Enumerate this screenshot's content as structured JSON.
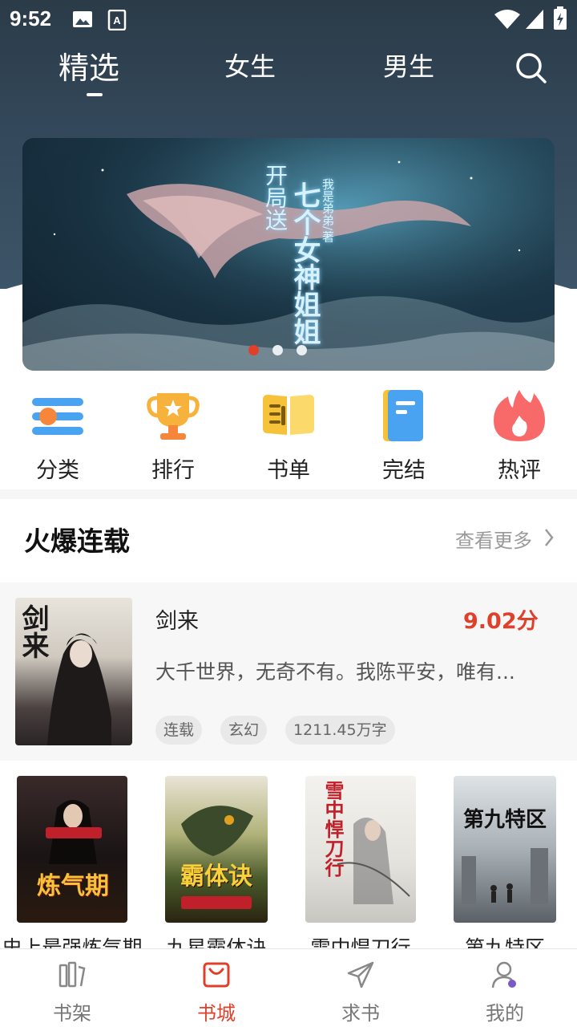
{
  "status": {
    "time": "9:52"
  },
  "tabs": [
    {
      "label": "精选",
      "active": true
    },
    {
      "label": "女生",
      "active": false
    },
    {
      "label": "男生",
      "active": false
    }
  ],
  "banner": {
    "text_left": "开局送",
    "text_main": "七个女神姐姐",
    "text_author": "我是弟弟/著",
    "active_dot": 0,
    "dot_count": 3
  },
  "categories": [
    {
      "label": "分类",
      "icon": "category-icon"
    },
    {
      "label": "排行",
      "icon": "trophy-icon"
    },
    {
      "label": "书单",
      "icon": "book-list-icon"
    },
    {
      "label": "完结",
      "icon": "completed-book-icon"
    },
    {
      "label": "热评",
      "icon": "flame-icon"
    }
  ],
  "section": {
    "title": "火爆连载",
    "more": "查看更多"
  },
  "featured": {
    "cover_text": "剑来",
    "title": "剑来",
    "score": "9.02分",
    "desc": "大千世界，无奇不有。我陈平安，唯有...",
    "tags": [
      "连载",
      "玄幻",
      "1211.45万字"
    ]
  },
  "grid": [
    {
      "title": "史上最强炼气期",
      "cover_text": "炼气期"
    },
    {
      "title": "九星霸体诀",
      "cover_text": "霸体诀"
    },
    {
      "title": "雪中悍刀行",
      "cover_text": "雪中悍刀行"
    },
    {
      "title": "第九特区",
      "cover_text": "第九特区"
    }
  ],
  "bottom_nav": [
    {
      "label": "书架",
      "icon": "bookshelf-icon",
      "active": false
    },
    {
      "label": "书城",
      "icon": "bookstore-bag-icon",
      "active": true
    },
    {
      "label": "求书",
      "icon": "paper-plane-icon",
      "active": false
    },
    {
      "label": "我的",
      "icon": "profile-icon",
      "active": false
    }
  ],
  "colors": {
    "accent": "#e0402a",
    "header": "#33485a"
  }
}
